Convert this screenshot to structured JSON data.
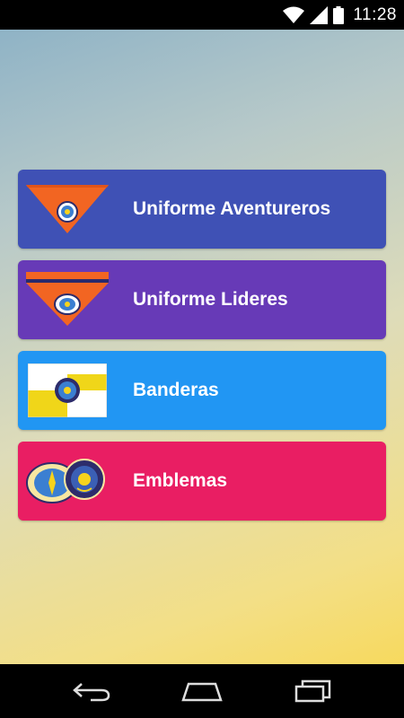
{
  "status_bar": {
    "time": "11:28",
    "icons": [
      "wifi-icon",
      "signal-icon",
      "battery-icon"
    ]
  },
  "menu": {
    "items": [
      {
        "label": "Uniforme Aventureros",
        "color": "#3f51b5",
        "icon": "scarf-orange-icon"
      },
      {
        "label": "Uniforme Lideres",
        "color": "#673ab7",
        "icon": "scarf-leader-icon"
      },
      {
        "label": "Banderas",
        "color": "#2196f3",
        "icon": "flag-icon"
      },
      {
        "label": "Emblemas",
        "color": "#e91e63",
        "icon": "emblems-icon"
      }
    ]
  },
  "nav_bar": {
    "icons": [
      "back-icon",
      "home-icon",
      "recent-apps-icon"
    ]
  }
}
